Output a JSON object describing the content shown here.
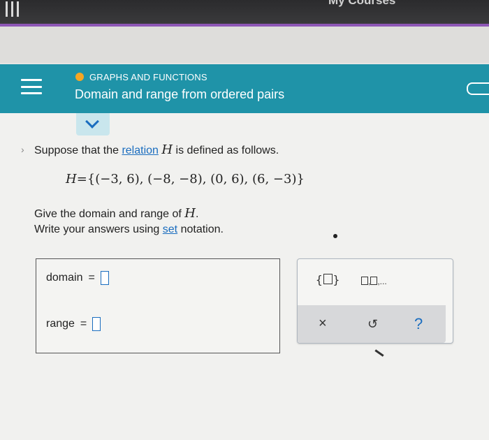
{
  "top_bar": {
    "title": "My Courses"
  },
  "header": {
    "topic": "GRAPHS AND FUNCTIONS",
    "heading": "Domain and range from ordered pairs"
  },
  "question": {
    "intro_before": "Suppose that the ",
    "intro_link": "relation",
    "intro_var": "H",
    "intro_after": " is defined as follows.",
    "math_var": "H",
    "math_set": "={(−3, 6), (−8, −8), (0, 6), (6, −3)}",
    "line1_before": "Give the domain and range of ",
    "line1_var": "H",
    "line1_after": ".",
    "line2_before": "Write your answers using ",
    "line2_link": "set",
    "line2_after": " notation."
  },
  "answer": {
    "domain_label": "domain",
    "range_label": "range",
    "equals": "="
  },
  "tools": {
    "brace_open": "{",
    "brace_close": "}",
    "list_sep": ",",
    "list_ellipsis": ",...",
    "clear": "×",
    "undo": "↺",
    "help": "?"
  }
}
